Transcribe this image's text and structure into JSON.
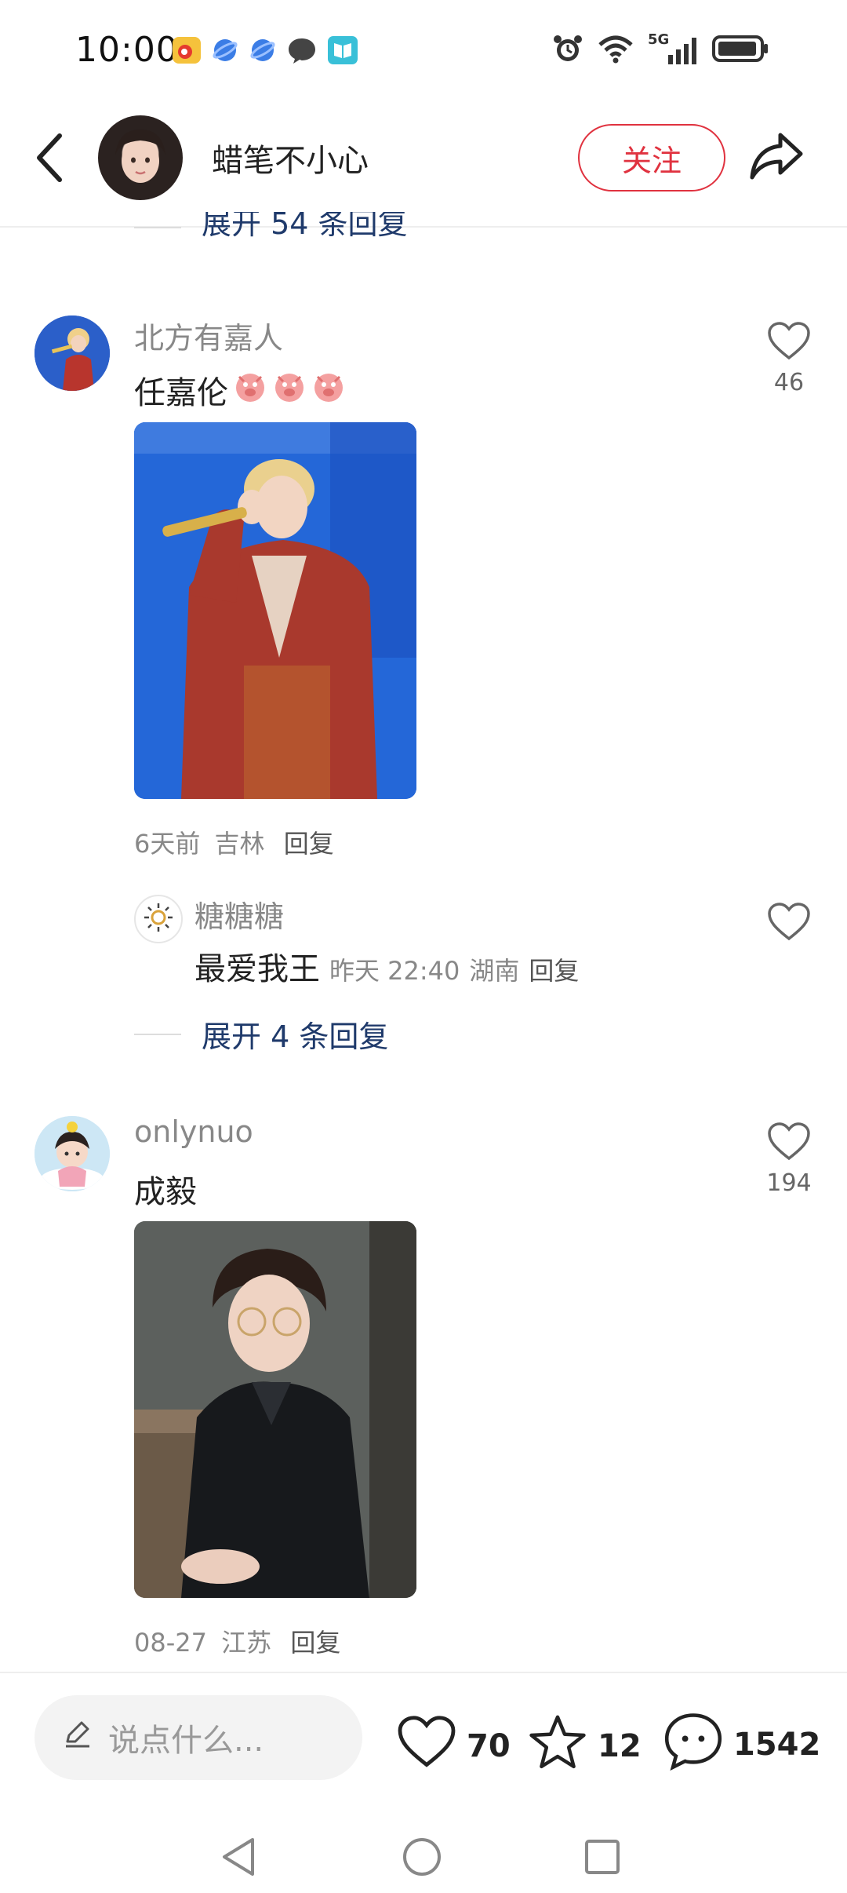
{
  "status_bar": {
    "time": "10:00",
    "network": "5G"
  },
  "header": {
    "back_icon": "chevron-left-icon",
    "username": "蜡笔不小心",
    "follow_label": "关注",
    "share_icon": "share-arrow-icon"
  },
  "top_expand": {
    "label": "展开 54 条回复"
  },
  "comments": [
    {
      "username": "北方有嘉人",
      "text": "任嘉伦",
      "emoji_count": 3,
      "likes": "46",
      "meta_time": "6天前",
      "meta_location": "吉林",
      "reply_label": "回复",
      "sub_reply": {
        "username": "糖糖糖",
        "text": "最爱我王",
        "time": "昨天 22:40",
        "location": "湖南",
        "reply_label": "回复"
      },
      "expand_label": "展开 4 条回复"
    },
    {
      "username": "onlynuo",
      "text": "成毅",
      "likes": "194",
      "meta_time": "08-27",
      "meta_location": "江苏",
      "reply_label": "回复"
    }
  ],
  "bottom_bar": {
    "input_placeholder": "说点什么...",
    "like_count": "70",
    "favorite_count": "12",
    "comment_count": "1542"
  },
  "colors": {
    "accent": "#e0323f",
    "link": "#1f3a6b"
  }
}
